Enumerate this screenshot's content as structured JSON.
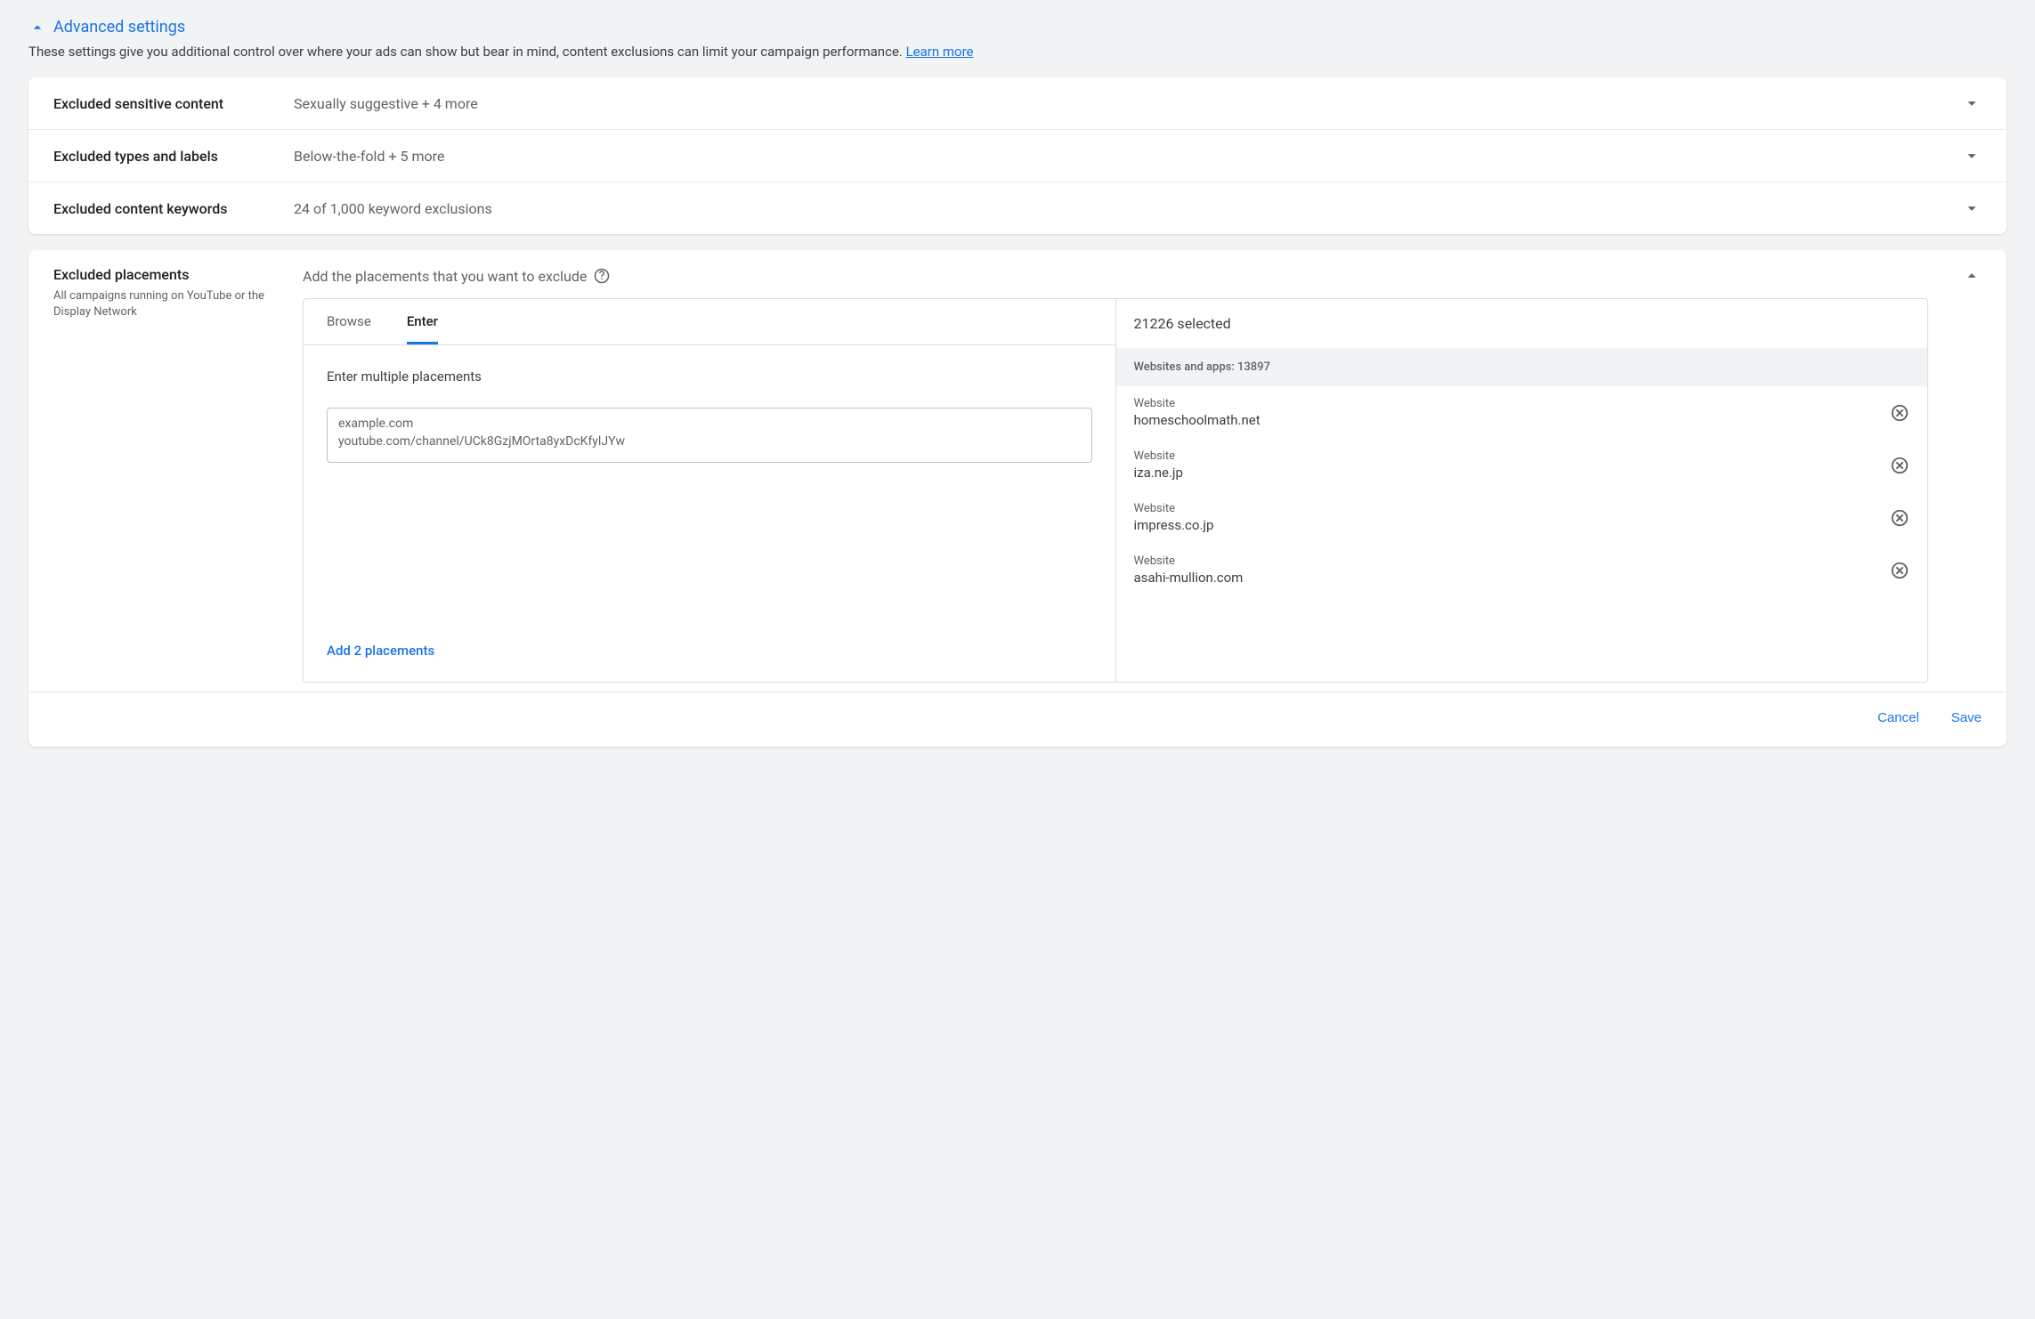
{
  "header": {
    "title": "Advanced settings",
    "subtitle": "These settings give you additional control over where your ads can show but bear in mind, content exclusions can limit your campaign performance. ",
    "learn_more": "Learn more"
  },
  "rows": [
    {
      "label": "Excluded sensitive content",
      "value": "Sexually suggestive + 4 more"
    },
    {
      "label": "Excluded types and labels",
      "value": "Below-the-fold + 5 more"
    },
    {
      "label": "Excluded content keywords",
      "value": "24 of 1,000 keyword exclusions"
    }
  ],
  "placements": {
    "title": "Excluded placements",
    "subtitle": "All campaigns running on YouTube or the Display Network",
    "instruction": "Add the placements that you want to exclude",
    "tabs": {
      "browse": "Browse",
      "enter": "Enter"
    },
    "enter_label": "Enter multiple placements",
    "textarea_value": "example.com\nyoutube.com/channel/UCk8GzjMOrta8yxDcKfylJYw",
    "add_label": "Add 2 placements",
    "selected_count": "21226 selected",
    "group_header": "Websites and apps: 13897",
    "item_type_label": "Website",
    "items": [
      "homeschoolmath.net",
      "iza.ne.jp",
      "impress.co.jp",
      "asahi-mullion.com"
    ]
  },
  "footer": {
    "cancel": "Cancel",
    "save": "Save"
  }
}
